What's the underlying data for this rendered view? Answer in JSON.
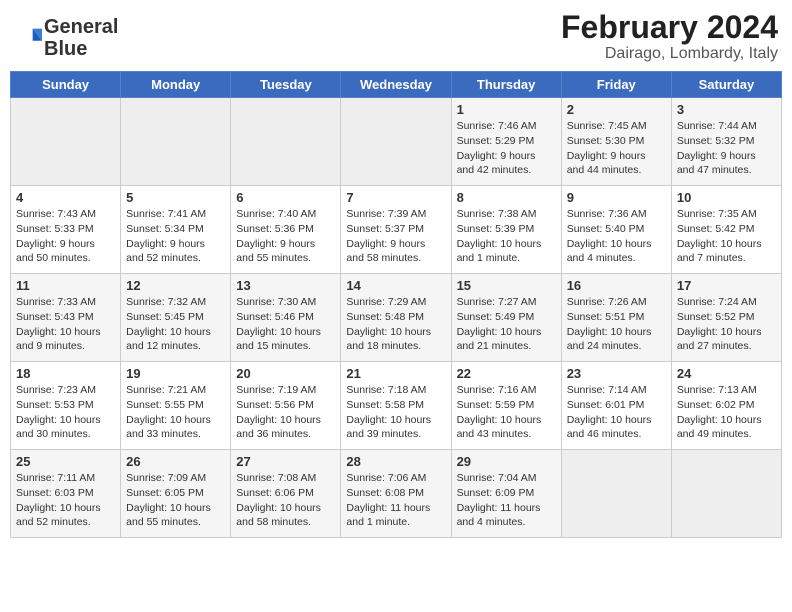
{
  "header": {
    "logo_line1": "General",
    "logo_line2": "Blue",
    "title": "February 2024",
    "subtitle": "Dairago, Lombardy, Italy"
  },
  "days_of_week": [
    "Sunday",
    "Monday",
    "Tuesday",
    "Wednesday",
    "Thursday",
    "Friday",
    "Saturday"
  ],
  "weeks": [
    [
      {
        "day": "",
        "info": ""
      },
      {
        "day": "",
        "info": ""
      },
      {
        "day": "",
        "info": ""
      },
      {
        "day": "",
        "info": ""
      },
      {
        "day": "1",
        "info": "Sunrise: 7:46 AM\nSunset: 5:29 PM\nDaylight: 9 hours\nand 42 minutes."
      },
      {
        "day": "2",
        "info": "Sunrise: 7:45 AM\nSunset: 5:30 PM\nDaylight: 9 hours\nand 44 minutes."
      },
      {
        "day": "3",
        "info": "Sunrise: 7:44 AM\nSunset: 5:32 PM\nDaylight: 9 hours\nand 47 minutes."
      }
    ],
    [
      {
        "day": "4",
        "info": "Sunrise: 7:43 AM\nSunset: 5:33 PM\nDaylight: 9 hours\nand 50 minutes."
      },
      {
        "day": "5",
        "info": "Sunrise: 7:41 AM\nSunset: 5:34 PM\nDaylight: 9 hours\nand 52 minutes."
      },
      {
        "day": "6",
        "info": "Sunrise: 7:40 AM\nSunset: 5:36 PM\nDaylight: 9 hours\nand 55 minutes."
      },
      {
        "day": "7",
        "info": "Sunrise: 7:39 AM\nSunset: 5:37 PM\nDaylight: 9 hours\nand 58 minutes."
      },
      {
        "day": "8",
        "info": "Sunrise: 7:38 AM\nSunset: 5:39 PM\nDaylight: 10 hours\nand 1 minute."
      },
      {
        "day": "9",
        "info": "Sunrise: 7:36 AM\nSunset: 5:40 PM\nDaylight: 10 hours\nand 4 minutes."
      },
      {
        "day": "10",
        "info": "Sunrise: 7:35 AM\nSunset: 5:42 PM\nDaylight: 10 hours\nand 7 minutes."
      }
    ],
    [
      {
        "day": "11",
        "info": "Sunrise: 7:33 AM\nSunset: 5:43 PM\nDaylight: 10 hours\nand 9 minutes."
      },
      {
        "day": "12",
        "info": "Sunrise: 7:32 AM\nSunset: 5:45 PM\nDaylight: 10 hours\nand 12 minutes."
      },
      {
        "day": "13",
        "info": "Sunrise: 7:30 AM\nSunset: 5:46 PM\nDaylight: 10 hours\nand 15 minutes."
      },
      {
        "day": "14",
        "info": "Sunrise: 7:29 AM\nSunset: 5:48 PM\nDaylight: 10 hours\nand 18 minutes."
      },
      {
        "day": "15",
        "info": "Sunrise: 7:27 AM\nSunset: 5:49 PM\nDaylight: 10 hours\nand 21 minutes."
      },
      {
        "day": "16",
        "info": "Sunrise: 7:26 AM\nSunset: 5:51 PM\nDaylight: 10 hours\nand 24 minutes."
      },
      {
        "day": "17",
        "info": "Sunrise: 7:24 AM\nSunset: 5:52 PM\nDaylight: 10 hours\nand 27 minutes."
      }
    ],
    [
      {
        "day": "18",
        "info": "Sunrise: 7:23 AM\nSunset: 5:53 PM\nDaylight: 10 hours\nand 30 minutes."
      },
      {
        "day": "19",
        "info": "Sunrise: 7:21 AM\nSunset: 5:55 PM\nDaylight: 10 hours\nand 33 minutes."
      },
      {
        "day": "20",
        "info": "Sunrise: 7:19 AM\nSunset: 5:56 PM\nDaylight: 10 hours\nand 36 minutes."
      },
      {
        "day": "21",
        "info": "Sunrise: 7:18 AM\nSunset: 5:58 PM\nDaylight: 10 hours\nand 39 minutes."
      },
      {
        "day": "22",
        "info": "Sunrise: 7:16 AM\nSunset: 5:59 PM\nDaylight: 10 hours\nand 43 minutes."
      },
      {
        "day": "23",
        "info": "Sunrise: 7:14 AM\nSunset: 6:01 PM\nDaylight: 10 hours\nand 46 minutes."
      },
      {
        "day": "24",
        "info": "Sunrise: 7:13 AM\nSunset: 6:02 PM\nDaylight: 10 hours\nand 49 minutes."
      }
    ],
    [
      {
        "day": "25",
        "info": "Sunrise: 7:11 AM\nSunset: 6:03 PM\nDaylight: 10 hours\nand 52 minutes."
      },
      {
        "day": "26",
        "info": "Sunrise: 7:09 AM\nSunset: 6:05 PM\nDaylight: 10 hours\nand 55 minutes."
      },
      {
        "day": "27",
        "info": "Sunrise: 7:08 AM\nSunset: 6:06 PM\nDaylight: 10 hours\nand 58 minutes."
      },
      {
        "day": "28",
        "info": "Sunrise: 7:06 AM\nSunset: 6:08 PM\nDaylight: 11 hours\nand 1 minute."
      },
      {
        "day": "29",
        "info": "Sunrise: 7:04 AM\nSunset: 6:09 PM\nDaylight: 11 hours\nand 4 minutes."
      },
      {
        "day": "",
        "info": ""
      },
      {
        "day": "",
        "info": ""
      }
    ]
  ]
}
